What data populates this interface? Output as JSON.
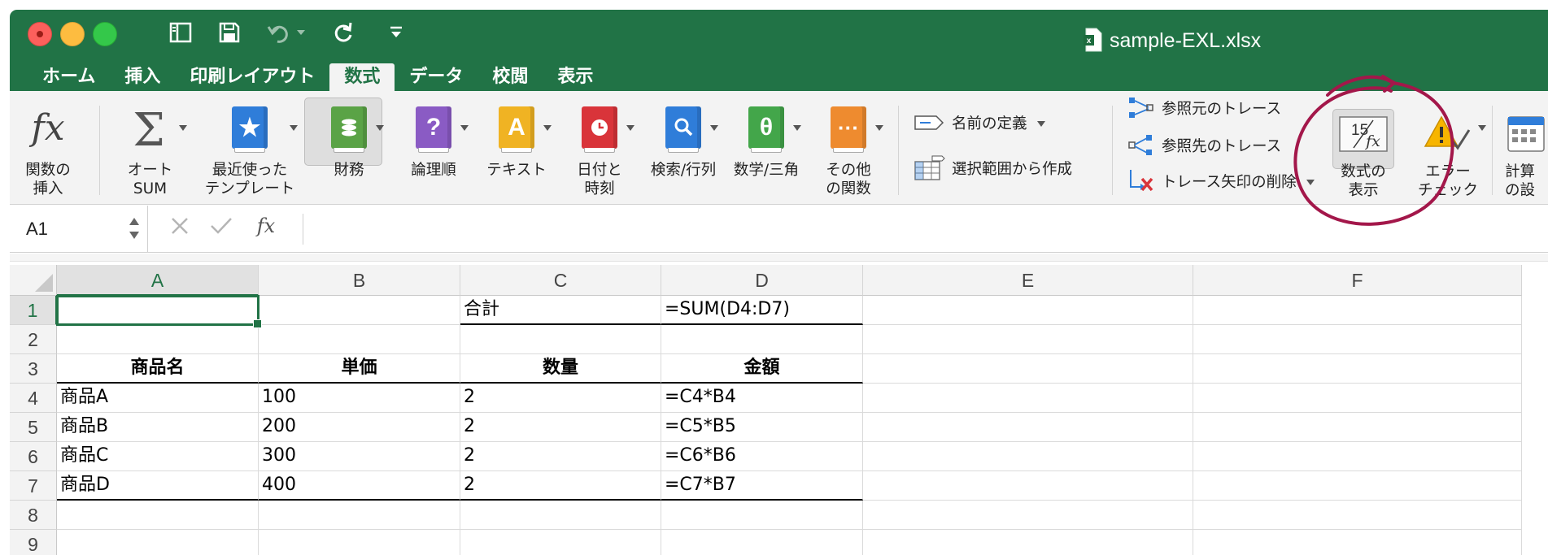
{
  "window": {
    "title": "sample-EXL.xlsx"
  },
  "tabs": [
    {
      "label": "ホーム",
      "active": false
    },
    {
      "label": "挿入",
      "active": false
    },
    {
      "label": "印刷レイアウト",
      "active": false
    },
    {
      "label": "数式",
      "active": true
    },
    {
      "label": "データ",
      "active": false
    },
    {
      "label": "校閲",
      "active": false
    },
    {
      "label": "表示",
      "active": false
    }
  ],
  "ribbon": {
    "insert_function": "関数の\n挿入",
    "autosum": "オート\nSUM",
    "recent": "最近使った\nテンプレート",
    "financial": "財務",
    "logical": "論理順",
    "text": "テキスト",
    "datetime": "日付と\n時刻",
    "lookup": "検索/行列",
    "math": "数学/三角",
    "more": "その他\nの関数",
    "define_name": "名前の定義",
    "create_from_selection": "選択範囲から作成",
    "trace_precedents": "参照元のトレース",
    "trace_dependents": "参照先のトレース",
    "remove_arrows": "トレース矢印の削除",
    "show_formulas": "数式の\n表示",
    "error_check": "エラー\nチェック",
    "calc_options": "計算\nの設",
    "show_formulas_icon_number": "15",
    "colors": {
      "financial": "#5aa346",
      "logical": "#8a5bc4",
      "text": "#f0b323",
      "datetime": "#d9343a",
      "lookup": "#2f7dd9",
      "math": "#43a64a",
      "more": "#ee8b2f",
      "recent": "#2f7dd9"
    }
  },
  "formula_bar": {
    "name_box": "A1",
    "formula": ""
  },
  "sheet": {
    "columns": [
      "A",
      "B",
      "C",
      "D",
      "E",
      "F"
    ],
    "rows": [
      "1",
      "2",
      "3",
      "4",
      "5",
      "6",
      "7",
      "8",
      "9"
    ],
    "cells": {
      "C1": "合計",
      "D1": "=SUM(D4:D7)",
      "A3": "商品名",
      "B3": "単価",
      "C3": "数量",
      "D3": "金額",
      "A4": "商品A",
      "B4": "100",
      "C4": "2",
      "D4": "=C4*B4",
      "A5": "商品B",
      "B5": "200",
      "C5": "2",
      "D5": "=C5*B5",
      "A6": "商品C",
      "B6": "300",
      "C6": "2",
      "D6": "=C6*B6",
      "A7": "商品D",
      "B7": "400",
      "C7": "2",
      "D7": "=C7*B7"
    },
    "active_cell": "A1",
    "accent": "#217346",
    "annotation_color": "#a3174a"
  }
}
